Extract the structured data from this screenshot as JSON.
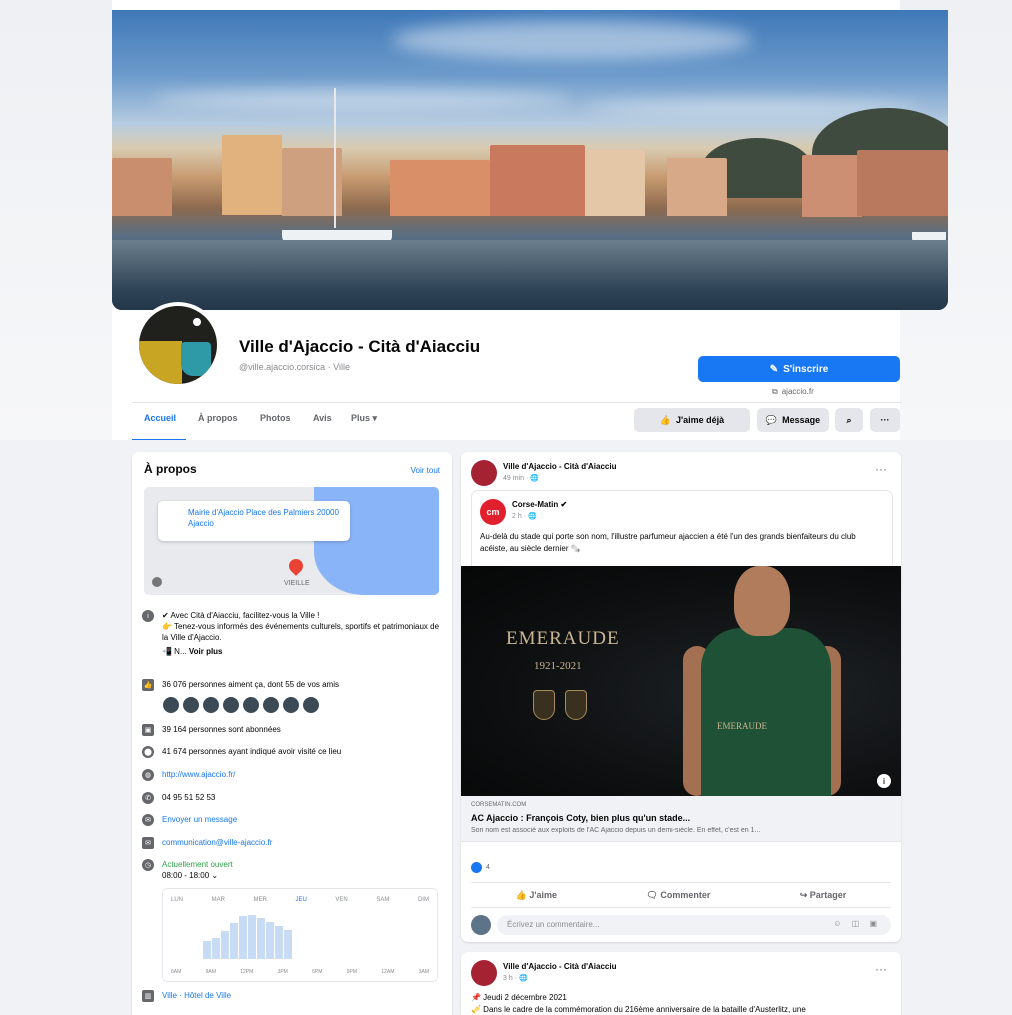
{
  "page": {
    "name": "Ville d'Ajaccio - Cità d'Aiacciu",
    "handle": "@ville.ajaccio.corsica · Ville",
    "subscribe_label": "S'inscrire",
    "website": "ajaccio.fr"
  },
  "tabs": [
    {
      "label": "Accueil"
    },
    {
      "label": "À propos"
    },
    {
      "label": "Photos"
    },
    {
      "label": "Avis"
    },
    {
      "label": "Plus ▾"
    }
  ],
  "actions": {
    "like": "J'aime déjà",
    "message": "Message"
  },
  "about": {
    "title": "À propos",
    "see_all": "Voir tout",
    "address": "Mairie d'Ajaccio Place des Palmiers 20000 Ajaccio",
    "map_label": "VIEILLE",
    "intro_1": "✔ Avec Cità d'Aiacciu, facilitez-vous la Ville !",
    "intro_2": "👉 Tenez-vous informés des événements culturels, sportifs et patrimoniaux de la Ville d'Ajaccio.",
    "intro_more_prefix": "📲 N...",
    "intro_more": "Voir plus",
    "likes": "36 076 personnes aiment ça, dont 55 de vos amis",
    "followers": "39 164 personnes sont abonnées",
    "checkins": "41 674 personnes ayant indiqué avoir visité ce lieu",
    "website": "http://www.ajaccio.fr/",
    "phone": "04 95 51 52 53",
    "send_message": "Envoyer un message",
    "email": "communication@ville-ajaccio.fr",
    "open_status": "Actuellement ouvert",
    "hours": "08:00 - 18:00 ⌄",
    "days": [
      "LUN",
      "MAR",
      "MER",
      "JEU",
      "VEN",
      "SAM",
      "DIM"
    ],
    "times": [
      "6AM",
      "9AM",
      "12PM",
      "3PM",
      "6PM",
      "9PM",
      "12AM",
      "3AM"
    ],
    "busyness": [
      0.35,
      0.42,
      0.55,
      0.72,
      0.85,
      0.88,
      0.82,
      0.74,
      0.66,
      0.58
    ],
    "category": "Ville · Hôtel de Ville"
  },
  "post": {
    "author": "Ville d'Ajaccio - Cità d'Aiacciu",
    "time": "49 min · 🌐",
    "shared_author": "Corse-Matin ✔",
    "shared_time": "2 h · 🌐",
    "shared_avatar": "cm",
    "text": "Au-delà du stade qui porte son nom, l'illustre parfumeur ajaccien a été l'un des grands bienfaiteurs du club acéiste, au siècle dernier 🗞️",
    "image_title": "EMERAUDE",
    "image_years": "1921-2021",
    "shirt_text": "EMERAUDE",
    "link_source": "CORSEMATIN.COM",
    "link_title": "AC Ajaccio : François Coty, bien plus qu'un stade...",
    "link_desc": "Son nom est associé aux exploits de l'AC Ajaccio depuis un demi-siècle. En effet, c'est en 1...",
    "reactions": "4",
    "like_label": "J'aime",
    "comment_label": "Commenter",
    "share_label": "Partager",
    "comment_placeholder": "Écrivez un commentaire..."
  },
  "post2": {
    "author": "Ville d'Ajaccio - Cità d'Aiacciu",
    "time": "3 h · 🌐",
    "line1": "📌 Jeudi 2 décembre 2021",
    "line2": "🎺 Dans le cadre de la commémoration du 216ème anniversaire de la bataille d'Austerlitz, une"
  },
  "colors": {
    "accent": "#1877f2",
    "open": "#31a24c",
    "feed_bg": "#f0f2f5"
  }
}
